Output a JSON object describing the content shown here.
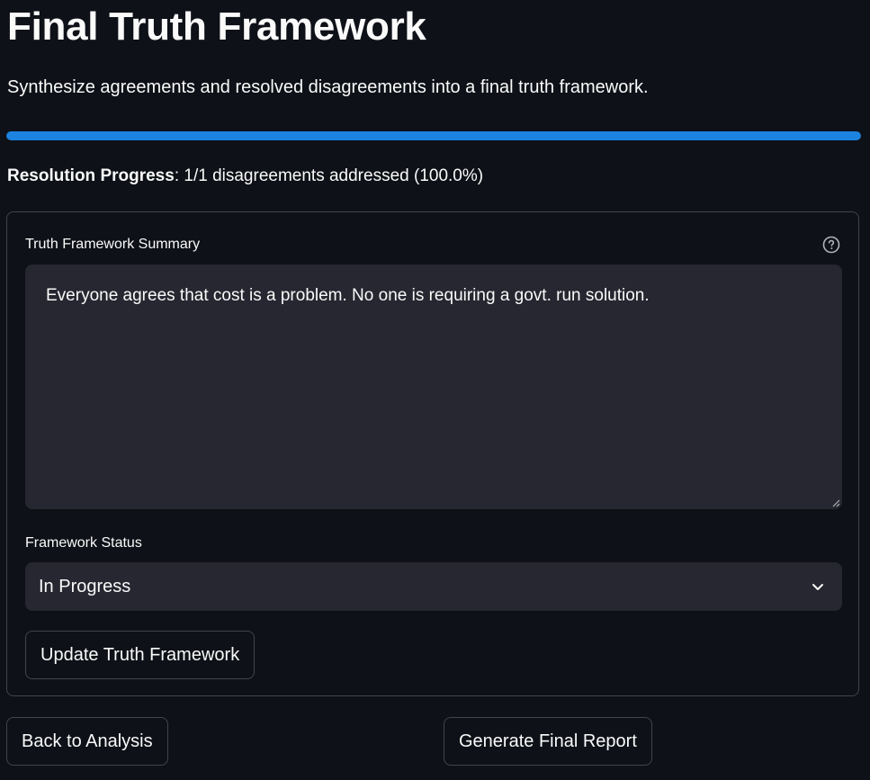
{
  "page": {
    "title": "Final Truth Framework",
    "subtitle": "Synthesize agreements and resolved disagreements into a final truth framework."
  },
  "progress": {
    "fraction": 1.0,
    "label_bold": "Resolution Progress",
    "label_rest": ": 1/1 disagreements addressed (100.0%)"
  },
  "form": {
    "summary_label": "Truth Framework Summary",
    "summary_help_icon": "question-circle-icon",
    "summary_value": "Everyone agrees that cost is a problem. No one is requiring a govt. run solution.",
    "status_label": "Framework Status",
    "status_value": "In Progress",
    "update_button": "Update Truth Framework"
  },
  "actions": {
    "back_button": "Back to Analysis",
    "report_button": "Generate Final Report"
  },
  "colors": {
    "background": "#0e1117",
    "input_background": "#262730",
    "accent": "#1c83e1",
    "text": "#fafafa"
  }
}
